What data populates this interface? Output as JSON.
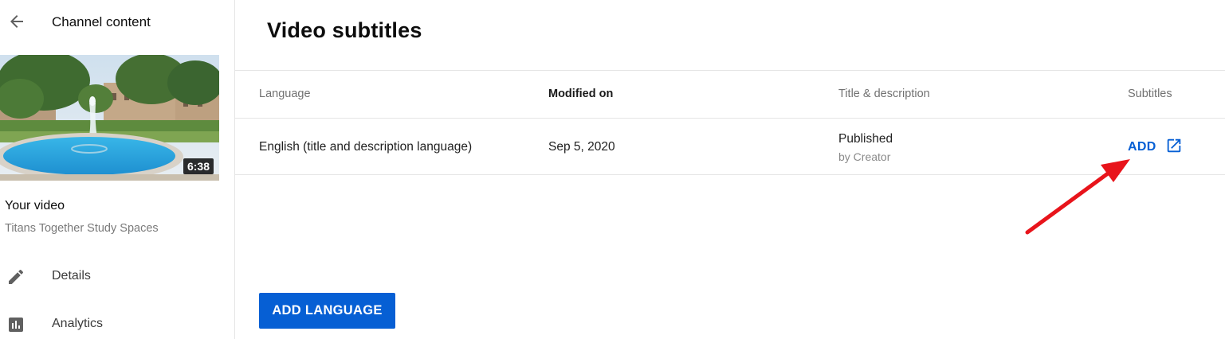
{
  "sidebar": {
    "back_label": "Channel content",
    "thumbnail": {
      "duration": "6:38"
    },
    "video_heading": "Your video",
    "video_name": "Titans Together Study Spaces",
    "nav": [
      {
        "label": "Details",
        "icon": "pencil-icon"
      },
      {
        "label": "Analytics",
        "icon": "analytics-icon"
      }
    ]
  },
  "main": {
    "title": "Video subtitles",
    "table": {
      "headers": {
        "language": "Language",
        "modified": "Modified on",
        "title_desc": "Title & description",
        "subtitles": "Subtitles"
      },
      "rows": [
        {
          "language": "English (title and description language)",
          "modified": "Sep 5, 2020",
          "status": "Published",
          "status_by": "by Creator",
          "subtitles_action": "ADD"
        }
      ]
    },
    "add_language_button": "ADD LANGUAGE"
  },
  "colors": {
    "accent": "#065fd4",
    "annotation_arrow": "#e8141b"
  }
}
